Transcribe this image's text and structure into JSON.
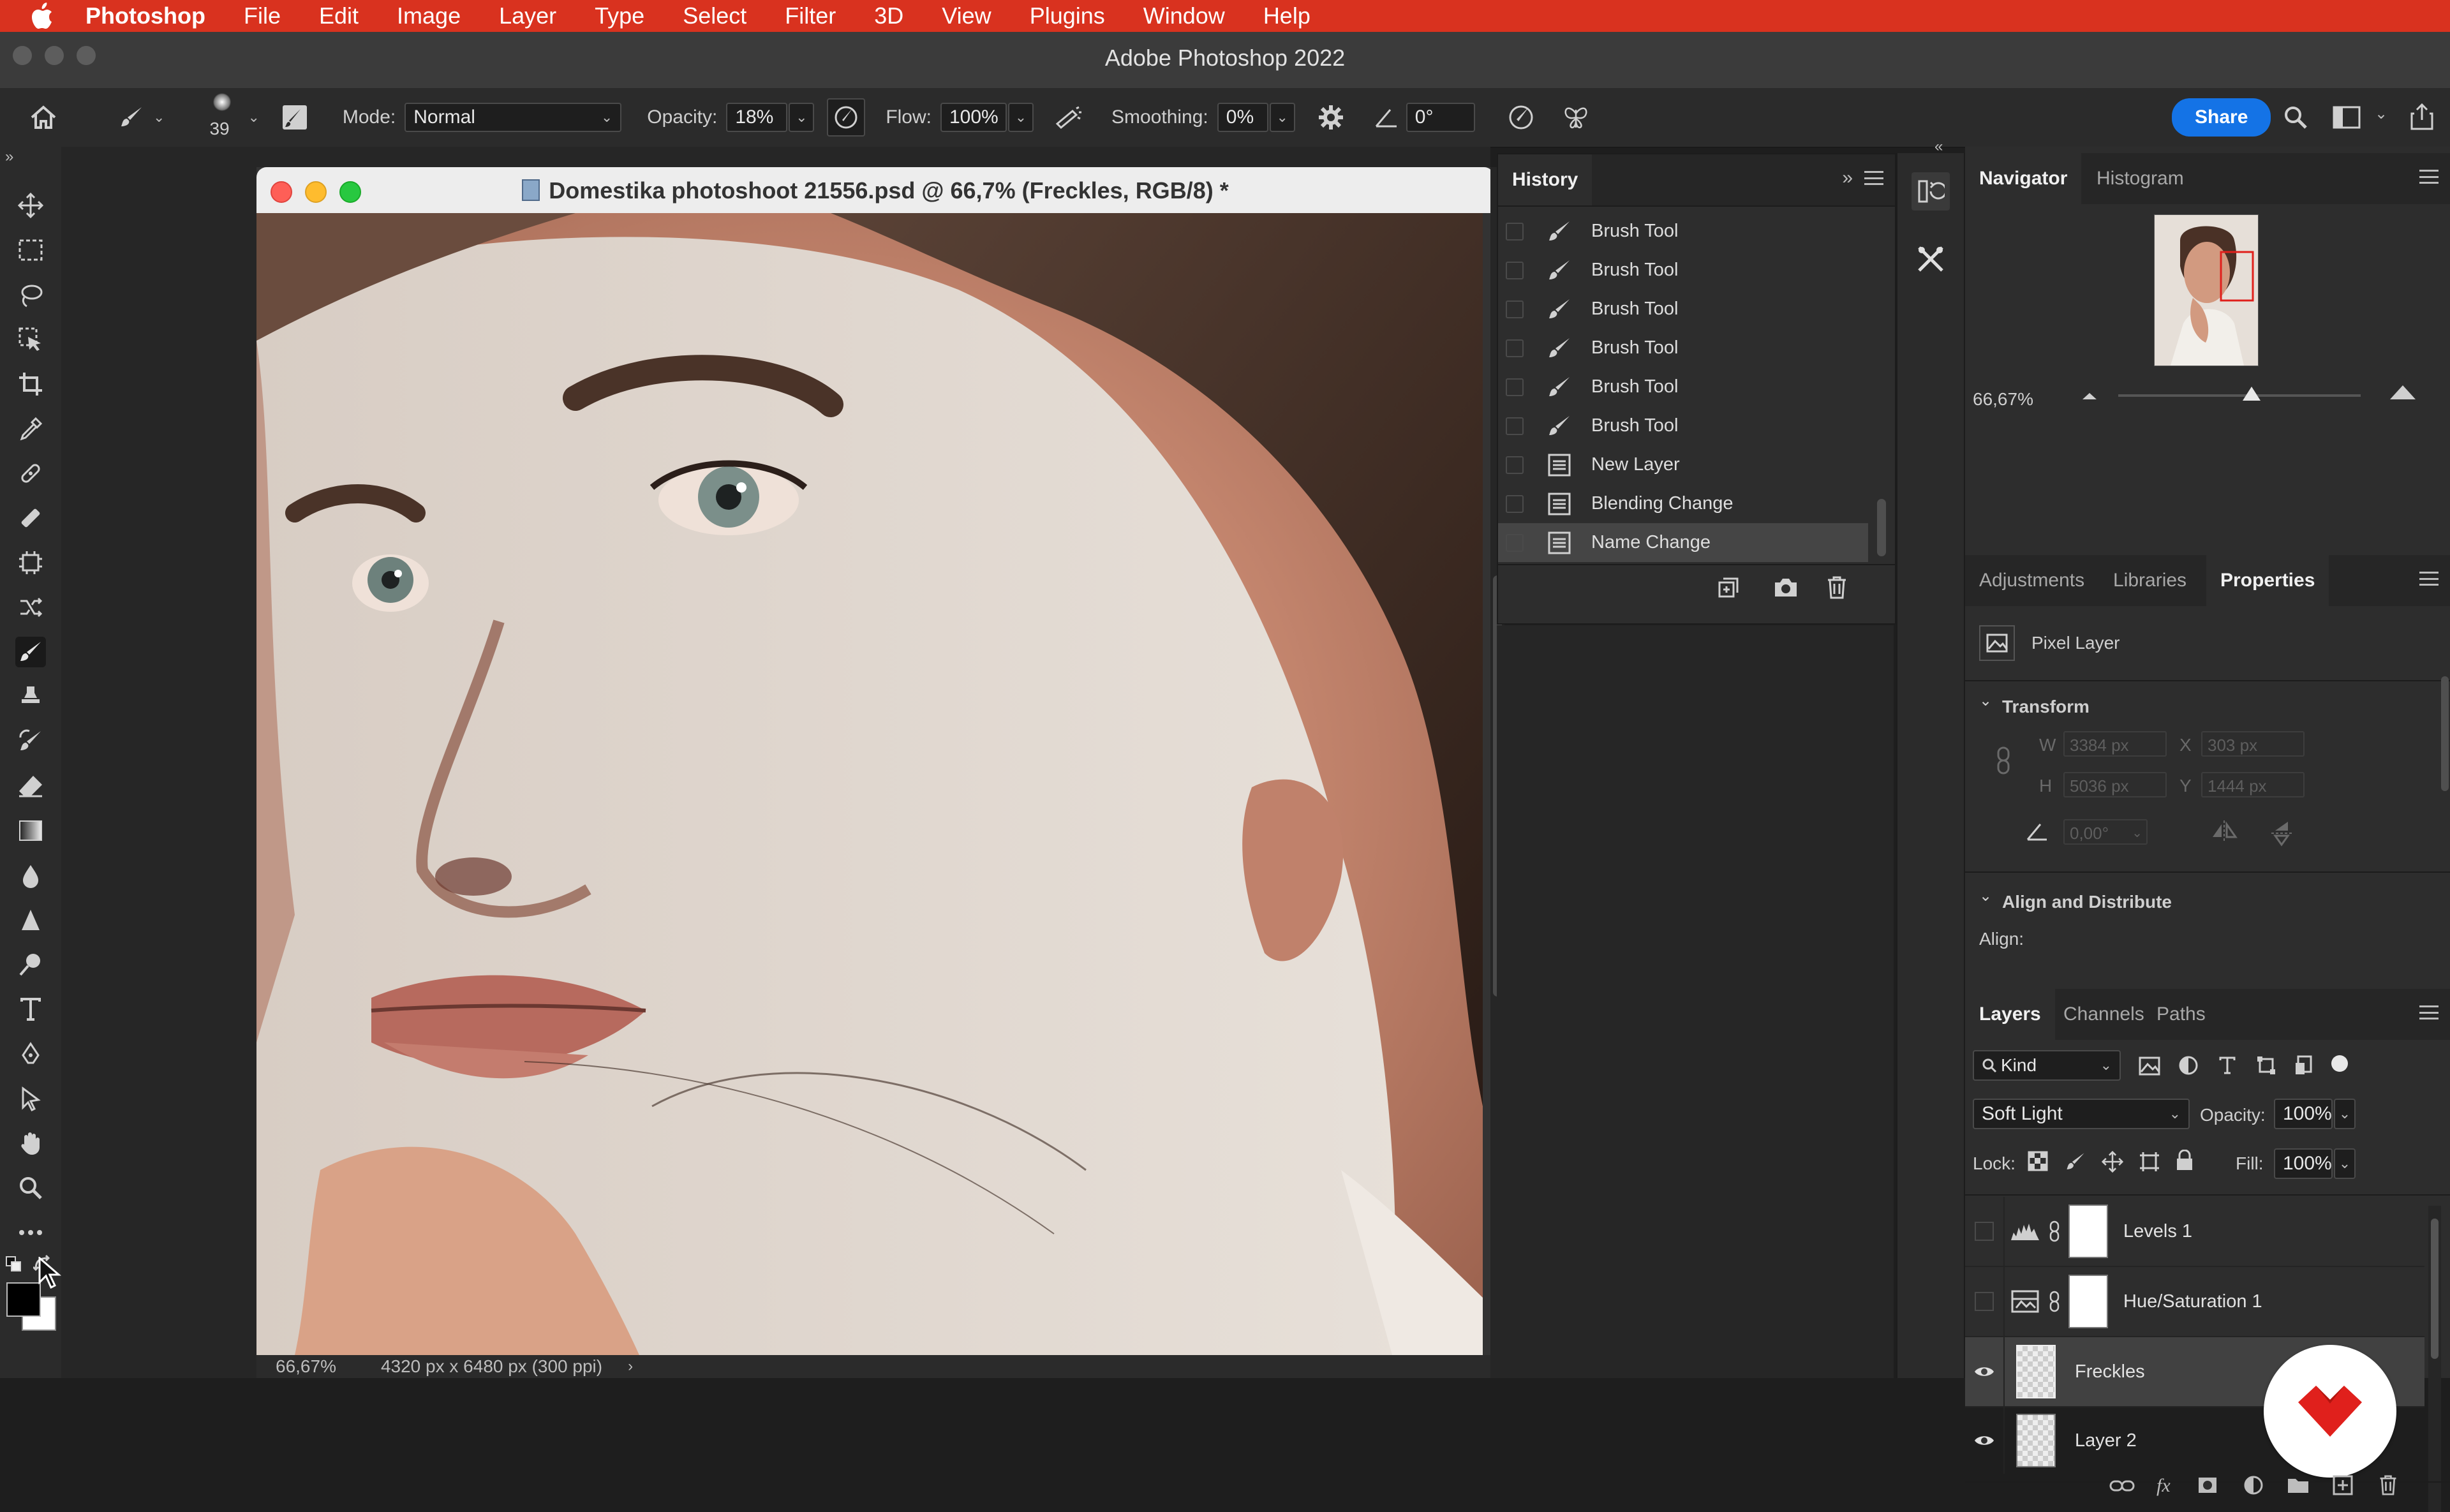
{
  "menubar": {
    "items": [
      "Photoshop",
      "File",
      "Edit",
      "Image",
      "Layer",
      "Type",
      "Select",
      "Filter",
      "3D",
      "View",
      "Plugins",
      "Window",
      "Help"
    ]
  },
  "window": {
    "title": "Adobe Photoshop 2022"
  },
  "options": {
    "brush_size": "39",
    "mode_label": "Mode:",
    "mode_value": "Normal",
    "opacity_label": "Opacity:",
    "opacity_value": "18%",
    "flow_label": "Flow:",
    "flow_value": "100%",
    "smoothing_label": "Smoothing:",
    "smoothing_value": "0%",
    "angle_value": "0°",
    "share_label": "Share"
  },
  "document": {
    "title": "Domestika photoshoot 21556.psd @ 66,7% (Freckles, RGB/8) *",
    "zoom": "66,67%",
    "dimensions": "4320 px x 6480 px (300 ppi)"
  },
  "history": {
    "tab": "History",
    "items": [
      {
        "label": "Brush Tool",
        "icon": "brush-icon"
      },
      {
        "label": "Brush Tool",
        "icon": "brush-icon"
      },
      {
        "label": "Brush Tool",
        "icon": "brush-icon"
      },
      {
        "label": "Brush Tool",
        "icon": "brush-icon"
      },
      {
        "label": "Brush Tool",
        "icon": "brush-icon"
      },
      {
        "label": "Brush Tool",
        "icon": "brush-icon"
      },
      {
        "label": "New Layer",
        "icon": "document-icon"
      },
      {
        "label": "Blending Change",
        "icon": "document-icon"
      },
      {
        "label": "Name Change",
        "icon": "document-icon"
      }
    ]
  },
  "navigator": {
    "tabs": [
      "Navigator",
      "Histogram"
    ],
    "zoom": "66,67%",
    "zoom_level": 0.55
  },
  "properties": {
    "tabs": [
      "Adjustments",
      "Libraries",
      "Properties"
    ],
    "layer_type": "Pixel Layer",
    "transform_title": "Transform",
    "w_label": "W",
    "w_value": "3384 px",
    "x_label": "X",
    "x_value": "303 px",
    "h_label": "H",
    "h_value": "5036 px",
    "y_label": "Y",
    "y_value": "1444 px",
    "angle_value": "0,00°",
    "align_title": "Align and Distribute",
    "align_label": "Align:"
  },
  "layers": {
    "tabs": [
      "Layers",
      "Channels",
      "Paths"
    ],
    "filter_kind": "Kind",
    "blend_mode": "Soft Light",
    "opacity_label": "Opacity:",
    "opacity_value": "100%",
    "lock_label": "Lock:",
    "fill_label": "Fill:",
    "fill_value": "100%",
    "items": [
      {
        "name": "Levels 1",
        "visible": false,
        "type": "adjustment"
      },
      {
        "name": "Hue/Saturation 1",
        "visible": false,
        "type": "adjustment"
      },
      {
        "name": "Freckles",
        "visible": true,
        "type": "pixel"
      },
      {
        "name": "Layer 2",
        "visible": true,
        "type": "pixel"
      }
    ],
    "footer_fx": "fx"
  },
  "colors": {
    "menubar": "#d9321f",
    "accent": "#1473e6",
    "logo": "#e0201c"
  }
}
